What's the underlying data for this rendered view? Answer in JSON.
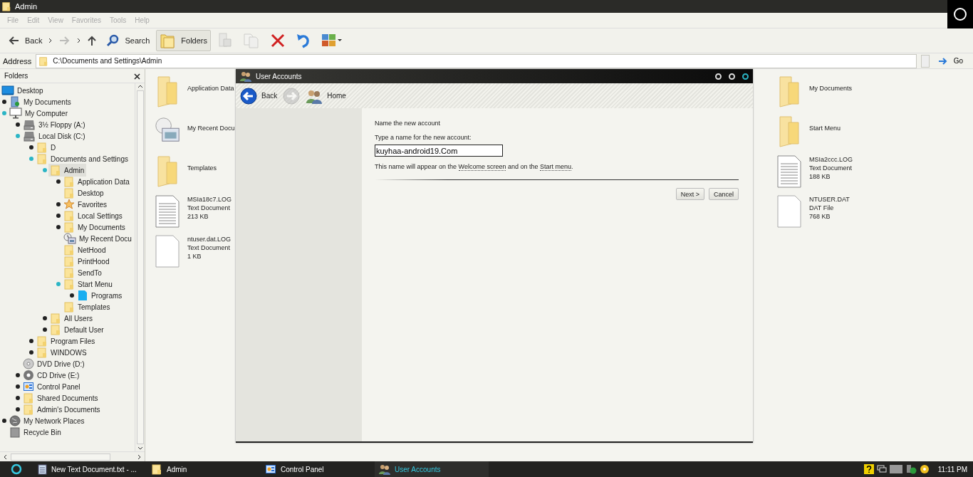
{
  "window": {
    "title": "Admin"
  },
  "menu": [
    "File",
    "Edit",
    "View",
    "Favorites",
    "Tools",
    "Help"
  ],
  "toolbar": [
    {
      "kind": "back",
      "label": "Back",
      "disabled": false,
      "selected": false
    },
    {
      "kind": "forward",
      "disabled": true,
      "selected": false
    },
    {
      "kind": "up",
      "disabled": false,
      "selected": false
    },
    {
      "kind": "search",
      "label": "Search",
      "disabled": false,
      "selected": false
    },
    {
      "kind": "folders",
      "label": "Folders",
      "disabled": false,
      "selected": true
    },
    {
      "kind": "move",
      "disabled": true,
      "selected": false
    },
    {
      "kind": "copy",
      "disabled": true,
      "selected": false
    },
    {
      "kind": "delete",
      "disabled": false,
      "selected": false
    },
    {
      "kind": "undo",
      "disabled": false,
      "selected": false
    },
    {
      "kind": "views",
      "disabled": false,
      "selected": false
    }
  ],
  "address": {
    "label": "Address",
    "value": "C:\\Documents and Settings\\Admin",
    "go": "Go"
  },
  "folders_pane": {
    "title": "Folders",
    "tree": [
      {
        "label": "Desktop",
        "kind": "desktop",
        "expandable": false,
        "expanded": true,
        "selected": false,
        "children": [
          {
            "label": "My Documents",
            "kind": "documents",
            "expandable": true,
            "expanded": false,
            "selected": false
          },
          {
            "label": "My Computer",
            "kind": "computer",
            "expandable": true,
            "expanded": true,
            "selected": false,
            "children": [
              {
                "label": "3½ Floppy (A:)",
                "kind": "drive",
                "expandable": true,
                "expanded": false,
                "selected": false
              },
              {
                "label": "Local Disk (C:)",
                "kind": "drive",
                "expandable": true,
                "expanded": true,
                "selected": false,
                "children": [
                  {
                    "label": "D",
                    "kind": "folder",
                    "expandable": true,
                    "expanded": false,
                    "selected": false
                  },
                  {
                    "label": "Documents and Settings",
                    "kind": "folder",
                    "expandable": true,
                    "expanded": true,
                    "selected": false,
                    "children": [
                      {
                        "label": "Admin",
                        "kind": "folder",
                        "expandable": true,
                        "expanded": true,
                        "selected": true,
                        "children": [
                          {
                            "label": "Application Data",
                            "kind": "folder",
                            "expandable": true,
                            "expanded": false,
                            "selected": false
                          },
                          {
                            "label": "Desktop",
                            "kind": "folder",
                            "expandable": false,
                            "selected": false
                          },
                          {
                            "label": "Favorites",
                            "kind": "favorites",
                            "expandable": true,
                            "expanded": false,
                            "selected": false
                          },
                          {
                            "label": "Local Settings",
                            "kind": "folder",
                            "expandable": true,
                            "expanded": false,
                            "selected": false
                          },
                          {
                            "label": "My Documents",
                            "kind": "folder",
                            "expandable": true,
                            "expanded": false,
                            "selected": false
                          },
                          {
                            "label": "My Recent Docu",
                            "kind": "recent",
                            "expandable": false,
                            "selected": false
                          },
                          {
                            "label": "NetHood",
                            "kind": "folder",
                            "expandable": false,
                            "selected": false
                          },
                          {
                            "label": "PrintHood",
                            "kind": "folder",
                            "expandable": false,
                            "selected": false
                          },
                          {
                            "label": "SendTo",
                            "kind": "folder",
                            "expandable": false,
                            "selected": false
                          },
                          {
                            "label": "Start Menu",
                            "kind": "folder",
                            "expandable": true,
                            "expanded": true,
                            "selected": false,
                            "children": [
                              {
                                "label": "Programs",
                                "kind": "programs",
                                "expandable": true,
                                "expanded": false,
                                "selected": false
                              }
                            ]
                          },
                          {
                            "label": "Templates",
                            "kind": "folder",
                            "expandable": false,
                            "selected": false
                          }
                        ]
                      },
                      {
                        "label": "All Users",
                        "kind": "folder",
                        "expandable": true,
                        "expanded": false,
                        "selected": false
                      },
                      {
                        "label": "Default User",
                        "kind": "folder",
                        "expandable": true,
                        "expanded": false,
                        "selected": false
                      }
                    ]
                  },
                  {
                    "label": "Program Files",
                    "kind": "folder",
                    "expandable": true,
                    "expanded": false,
                    "selected": false
                  },
                  {
                    "label": "WINDOWS",
                    "kind": "folder",
                    "expandable": true,
                    "expanded": false,
                    "selected": false
                  }
                ]
              },
              {
                "label": "DVD Drive (D:)",
                "kind": "dvd",
                "expandable": false,
                "selected": false
              },
              {
                "label": "CD Drive (E:)",
                "kind": "cd",
                "expandable": true,
                "expanded": false,
                "selected": false
              },
              {
                "label": "Control Panel",
                "kind": "control",
                "expandable": true,
                "expanded": false,
                "selected": false
              },
              {
                "label": "Shared Documents",
                "kind": "folder",
                "expandable": true,
                "expanded": false,
                "selected": false
              },
              {
                "label": "Admin's Documents",
                "kind": "folder",
                "expandable": true,
                "expanded": false,
                "selected": false
              }
            ]
          },
          {
            "label": "My Network Places",
            "kind": "network",
            "expandable": true,
            "expanded": false,
            "selected": false
          },
          {
            "label": "Recycle Bin",
            "kind": "recycle",
            "expandable": false,
            "selected": false
          }
        ]
      }
    ]
  },
  "files_left": [
    {
      "name": "Application Data",
      "kind": "folder"
    },
    {
      "name": "My Recent Docu",
      "kind": "recent"
    },
    {
      "name": "Templates",
      "kind": "folder"
    },
    {
      "name": "MSIa18c7.LOG",
      "kind": "text",
      "lines": [
        "Text Document",
        "213 KB"
      ]
    },
    {
      "name": "ntuser.dat.LOG",
      "kind": "blank",
      "lines": [
        "Text Document",
        "1 KB"
      ]
    }
  ],
  "files_right": [
    {
      "name": "My Documents",
      "kind": "folder"
    },
    {
      "name": "Start Menu",
      "kind": "folder"
    },
    {
      "name": "MSIa2ccc.LOG",
      "kind": "text",
      "lines": [
        "Text Document",
        "188 KB"
      ]
    },
    {
      "name": "NTUSER.DAT",
      "kind": "blank",
      "lines": [
        "DAT File",
        "768 KB"
      ]
    }
  ],
  "dialog": {
    "title": "User Accounts",
    "nav": [
      {
        "kind": "back",
        "label": "Back",
        "disabled": false
      },
      {
        "kind": "forward",
        "disabled": true
      },
      {
        "kind": "home",
        "label": "Home",
        "disabled": false
      }
    ],
    "heading": "Name the new account",
    "field_label": "Type a name for the new account:",
    "field_value": "kuyhaa-android19.Com",
    "note": [
      "This name will appear on the ",
      "Welcome screen",
      " and on the ",
      "Start menu",
      "."
    ],
    "buttons": [
      "Next >",
      "Cancel"
    ]
  },
  "taskbar": {
    "items": [
      {
        "label": "New Text Document.txt - ...",
        "kind": "notepad",
        "selected": false
      },
      {
        "label": "Admin",
        "kind": "folder",
        "selected": false
      },
      {
        "label": "Control Panel",
        "kind": "control",
        "selected": false
      },
      {
        "label": "User Accounts",
        "kind": "users",
        "selected": true
      }
    ],
    "clock": "11:11 PM"
  }
}
